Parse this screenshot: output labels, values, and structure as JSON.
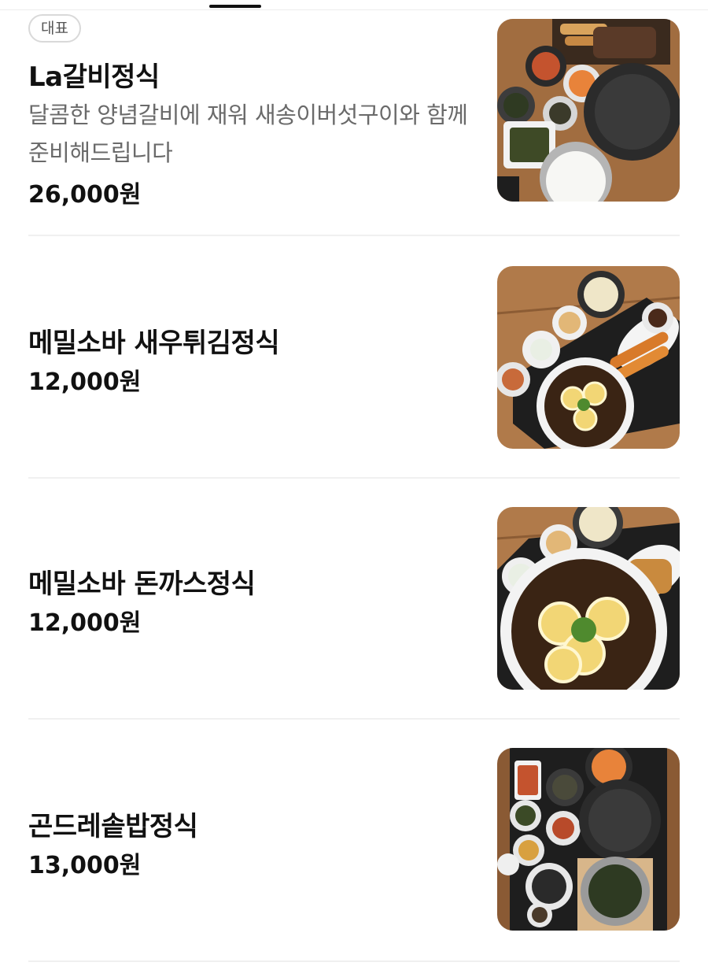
{
  "menu": {
    "items": [
      {
        "badge": "대표",
        "name": "La갈비정식",
        "description": "달콤한 양념갈비에 재워 새송이버섯구이와 함께 준비해드립니다",
        "price": "26,000원",
        "photo_icon": "la-galbi-set-photo"
      },
      {
        "name": "메밀소바 새우튀김정식",
        "price": "12,000원",
        "photo_icon": "soba-shrimp-tempura-set-photo"
      },
      {
        "name": "메밀소바 돈까스정식",
        "price": "12,000원",
        "photo_icon": "soba-pork-cutlet-set-photo"
      },
      {
        "name": "곤드레솥밥정식",
        "price": "13,000원",
        "photo_icon": "gondre-pot-rice-set-photo"
      }
    ]
  },
  "colors": {
    "wood_table": "#b07a4a",
    "tray": "#1e1e1e",
    "soba_broth": "#3a2414",
    "lemon": "#f2d675"
  }
}
